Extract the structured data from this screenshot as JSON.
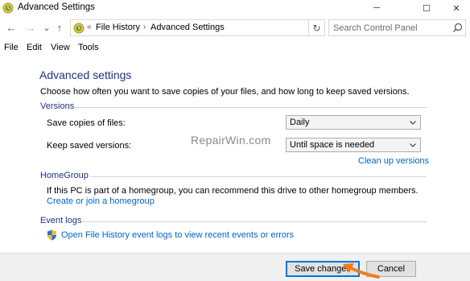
{
  "window": {
    "title": "Advanced Settings",
    "minimize_glyph": "─",
    "maximize_glyph": "☐",
    "close_glyph": "✕"
  },
  "nav": {
    "back_glyph": "←",
    "forward_glyph": "→",
    "recent_glyph": "⌄",
    "up_glyph": "↑",
    "chevron": "«",
    "breadcrumb": [
      "File History",
      "Advanced Settings"
    ],
    "separator": "›",
    "refresh_glyph": "↻",
    "search_placeholder": "Search Control Panel"
  },
  "menu": [
    "File",
    "Edit",
    "View",
    "Tools"
  ],
  "content": {
    "heading": "Advanced settings",
    "intro": "Choose how often you want to save copies of your files, and how long to keep saved versions.",
    "versions": {
      "label": "Versions",
      "save_copies_label": "Save copies of files:",
      "save_copies_value": "Daily",
      "keep_versions_label": "Keep saved versions:",
      "keep_versions_value": "Until space is needed",
      "cleanup_link": "Clean up versions"
    },
    "homegroup": {
      "label": "HomeGroup",
      "text": "If this PC is part of a homegroup, you can recommend this drive to other homegroup members.",
      "link": "Create or join a homegroup"
    },
    "event_logs": {
      "label": "Event logs",
      "link": "Open File History event logs to view recent events or errors"
    },
    "watermark": "RepairWin.com"
  },
  "footer": {
    "save_label": "Save changes",
    "cancel_label": "Cancel"
  },
  "colors": {
    "heading": "#1e3287",
    "link": "#0066cc",
    "annotation_arrow": "#f07c1e"
  },
  "icons": [
    "file-history-icon",
    "search-icon",
    "chevron-down-icon",
    "uac-shield-icon",
    "annotation-arrow-icon"
  ]
}
